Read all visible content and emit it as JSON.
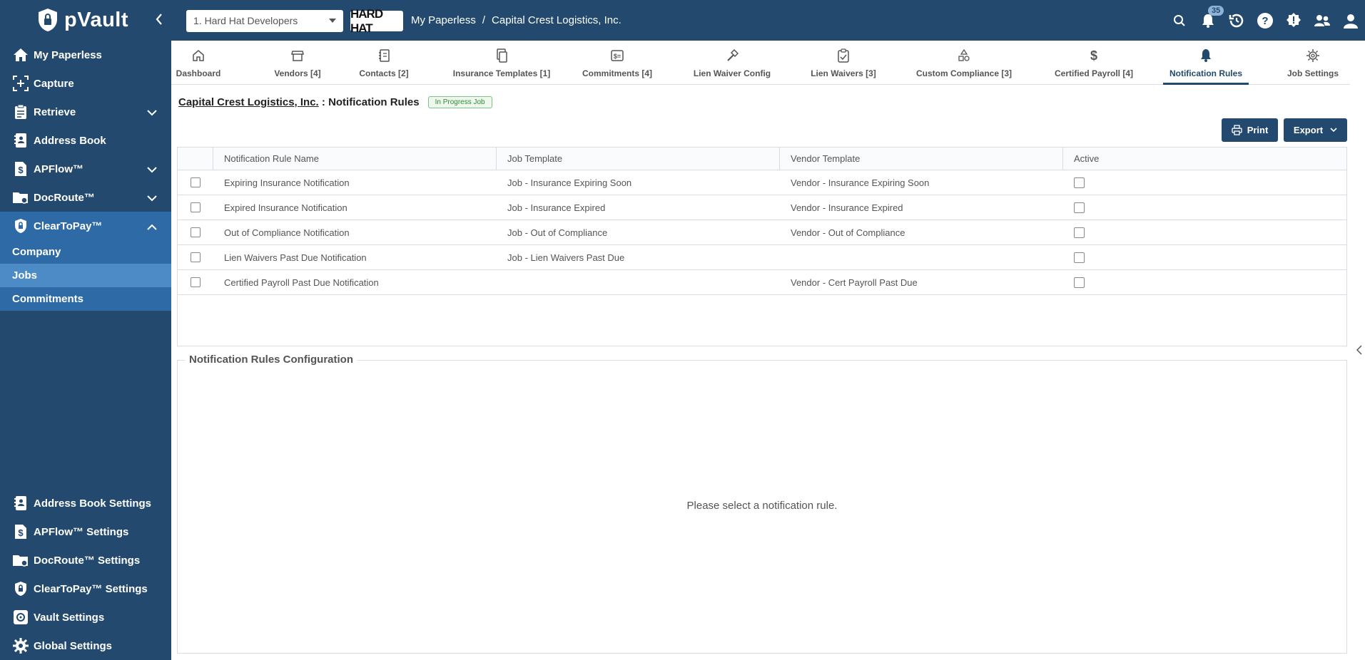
{
  "app": {
    "logo_text": "pVault",
    "colors": {
      "primary": "#234a6e",
      "accent": "#2d6aa6",
      "active_sub": "#4d8bc7",
      "status_green": "#2f8a33"
    }
  },
  "topbar": {
    "org_select_value": "1. Hard Hat Developers",
    "brand_text": "HARD HAT",
    "breadcrumb": [
      "My Paperless",
      "/",
      "Capital Crest Logistics, Inc."
    ],
    "notification_count": "35",
    "icons": [
      "search-icon",
      "bell-icon",
      "history-icon",
      "help-icon",
      "settings-icon",
      "users-icon",
      "profile-icon"
    ]
  },
  "sidebar": {
    "items": [
      {
        "label": "My Paperless",
        "icon": "home-icon"
      },
      {
        "label": "Capture",
        "icon": "capture-icon"
      },
      {
        "label": "Retrieve",
        "icon": "clipboard-icon",
        "expandable": true
      },
      {
        "label": "Address Book",
        "icon": "address-book-icon"
      },
      {
        "label": "APFlow™",
        "icon": "dollar-doc-icon",
        "expandable": true
      },
      {
        "label": "DocRoute™",
        "icon": "folder-route-icon",
        "expandable": true
      },
      {
        "label": "ClearToPay™",
        "icon": "shield-lock-icon",
        "expandable": true,
        "open": true
      }
    ],
    "sub_items": [
      {
        "label": "Company"
      },
      {
        "label": "Jobs",
        "active": true
      },
      {
        "label": "Commitments"
      }
    ],
    "bottom_items": [
      {
        "label": "Address Book Settings",
        "icon": "address-book-icon"
      },
      {
        "label": "APFlow™ Settings",
        "icon": "dollar-doc-icon"
      },
      {
        "label": "DocRoute™ Settings",
        "icon": "folder-route-icon"
      },
      {
        "label": "ClearToPay™ Settings",
        "icon": "shield-lock-icon"
      },
      {
        "label": "Vault Settings",
        "icon": "vault-icon"
      },
      {
        "label": "Global Settings",
        "icon": "gear-icon"
      }
    ]
  },
  "tabs": [
    {
      "label": "Dashboard",
      "icon": "home-icon"
    },
    {
      "label": "Vendors [4]",
      "icon": "store-icon"
    },
    {
      "label": "Contacts [2]",
      "icon": "contacts-icon"
    },
    {
      "label": "Insurance Templates [1]",
      "icon": "documents-icon"
    },
    {
      "label": "Commitments [4]",
      "icon": "commitment-icon"
    },
    {
      "label": "Lien Waiver Config",
      "icon": "hammer-icon"
    },
    {
      "label": "Lien Waivers [3]",
      "icon": "clipboard-check-icon"
    },
    {
      "label": "Custom Compliance [3]",
      "icon": "shapes-icon"
    },
    {
      "label": "Certified Payroll [4]",
      "icon": "dollar-icon"
    },
    {
      "label": "Notification Rules",
      "icon": "bell-icon",
      "active": true
    },
    {
      "label": "Job Settings",
      "icon": "gear-icon"
    }
  ],
  "page": {
    "company_link": "Capital Crest Logistics, Inc.",
    "separator": " : ",
    "title": "Notification Rules",
    "status": "In Progress Job",
    "print_label": "Print",
    "export_label": "Export"
  },
  "table": {
    "columns": [
      "Notification Rule Name",
      "Job Template",
      "Vendor Template",
      "Active"
    ],
    "rows": [
      {
        "name": "Expiring Insurance Notification",
        "job_template": "Job - Insurance Expiring Soon",
        "vendor_template": "Vendor - Insurance Expiring Soon",
        "active": false
      },
      {
        "name": "Expired Insurance Notification",
        "job_template": "Job - Insurance Expired",
        "vendor_template": "Vendor - Insurance Expired",
        "active": false
      },
      {
        "name": "Out of Compliance Notification",
        "job_template": "Job - Out of Compliance",
        "vendor_template": "Vendor - Out of Compliance",
        "active": false
      },
      {
        "name": "Lien Waivers Past Due Notification",
        "job_template": "Job - Lien Waivers Past Due",
        "vendor_template": "",
        "active": false
      },
      {
        "name": "Certified Payroll Past Due Notification",
        "job_template": "",
        "vendor_template": "Vendor - Cert Payroll Past Due",
        "active": false
      }
    ]
  },
  "config": {
    "title": "Notification Rules Configuration",
    "empty_message": "Please select a notification rule."
  }
}
